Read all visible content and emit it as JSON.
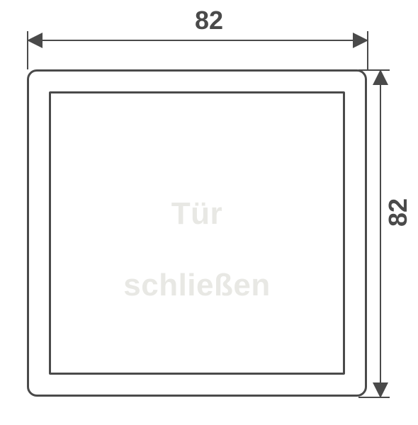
{
  "dimensions": {
    "width_label": "82",
    "height_label": "82"
  },
  "plate": {
    "text_line1": "Tür",
    "text_line2": "schließen"
  },
  "chart_data": {
    "type": "diagram",
    "object": "square push plate / door-close button, front view",
    "width_mm": 82,
    "height_mm": 82,
    "engraving_text": "Tür schließen",
    "corners": "rounded",
    "inner_frame": true
  }
}
